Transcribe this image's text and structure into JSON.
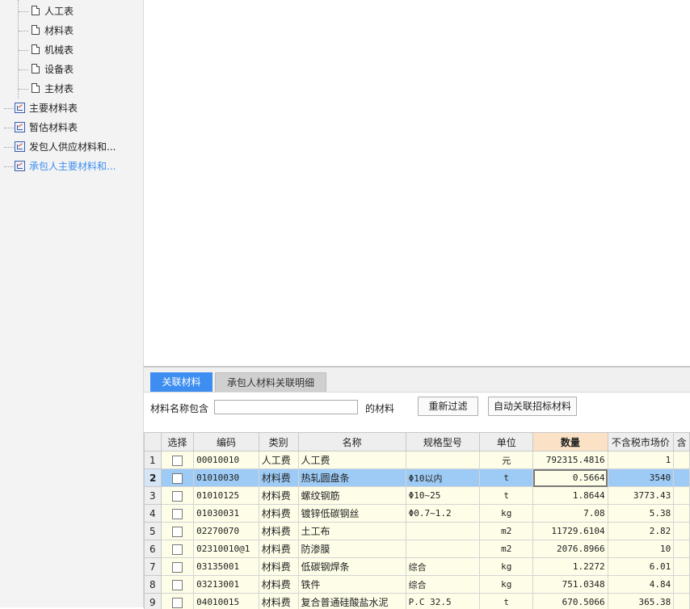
{
  "sidebar": {
    "items": [
      {
        "label": "人工表",
        "type": "doc"
      },
      {
        "label": "材料表",
        "type": "doc"
      },
      {
        "label": "机械表",
        "type": "doc"
      },
      {
        "label": "设备表",
        "type": "doc"
      },
      {
        "label": "主材表",
        "type": "doc"
      },
      {
        "label": "主要材料表",
        "type": "report"
      },
      {
        "label": "暂估材料表",
        "type": "report"
      },
      {
        "label": "发包人供应材料和...",
        "type": "report"
      },
      {
        "label": "承包人主要材料和...",
        "type": "report",
        "active": true
      }
    ]
  },
  "tabs": [
    {
      "label": "关联材料",
      "active": true
    },
    {
      "label": "承包人材料关联明细",
      "active": false
    }
  ],
  "filter": {
    "prefix_label": "材料名称包含",
    "input_value": "",
    "suffix_label": "的材料",
    "refilter_button": "重新过滤",
    "auto_link_button": "自动关联招标材料"
  },
  "grid": {
    "columns": [
      "",
      "选择",
      "编码",
      "类别",
      "名称",
      "规格型号",
      "单位",
      "数量",
      "不含税市场价",
      "含"
    ],
    "rows": [
      {
        "num": "1",
        "code": "00010010",
        "category": "人工费",
        "name": "人工费",
        "spec": "",
        "unit": "元",
        "qty": "792315.4816",
        "price": "1"
      },
      {
        "num": "2",
        "code": "01010030",
        "category": "材料费",
        "name": "热轧圆盘条",
        "spec": "Φ10以内",
        "unit": "t",
        "qty": "0.5664",
        "price": "3540",
        "selected": true
      },
      {
        "num": "3",
        "code": "01010125",
        "category": "材料费",
        "name": "螺纹钢筋",
        "spec": "Φ10~25",
        "unit": "t",
        "qty": "1.8644",
        "price": "3773.43"
      },
      {
        "num": "4",
        "code": "01030031",
        "category": "材料费",
        "name": "镀锌低碳钢丝",
        "spec": "Φ0.7~1.2",
        "unit": "kg",
        "qty": "7.08",
        "price": "5.38"
      },
      {
        "num": "5",
        "code": "02270070",
        "category": "材料费",
        "name": "土工布",
        "spec": "",
        "unit": "m2",
        "qty": "11729.6104",
        "price": "2.82"
      },
      {
        "num": "6",
        "code": "02310010@1",
        "category": "材料费",
        "name": "防渗膜",
        "spec": "",
        "unit": "m2",
        "qty": "2076.8966",
        "price": "10"
      },
      {
        "num": "7",
        "code": "03135001",
        "category": "材料费",
        "name": "低碳钢焊条",
        "spec": "综合",
        "unit": "kg",
        "qty": "1.2272",
        "price": "6.01"
      },
      {
        "num": "8",
        "code": "03213001",
        "category": "材料费",
        "name": "铁件",
        "spec": "综合",
        "unit": "kg",
        "qty": "751.0348",
        "price": "4.84"
      },
      {
        "num": "9",
        "code": "04010015",
        "category": "材料费",
        "name": "复合普通硅酸盐水泥",
        "spec": "P.C 32.5",
        "unit": "t",
        "qty": "670.5066",
        "price": "365.38"
      }
    ]
  }
}
